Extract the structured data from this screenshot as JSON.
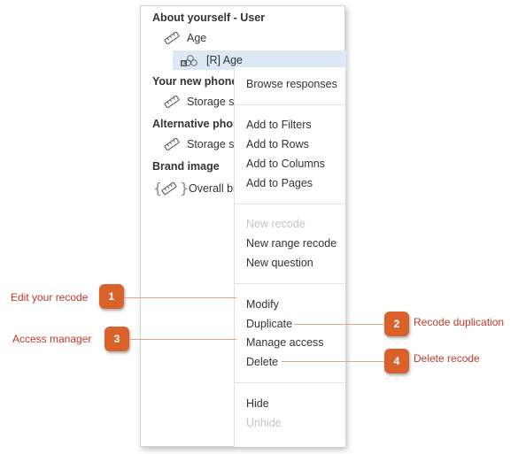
{
  "tree": {
    "group_about": "About yourself - User",
    "item_age": "Age",
    "item_recode_age": "[R] Age",
    "group_phone": "Your new phone",
    "item_storage_1": "Storage si",
    "group_alt": "Alternative phon",
    "item_storage_2": "Storage si",
    "group_brand": "Brand image",
    "item_overall": "Overall br"
  },
  "menu": {
    "browse_responses": "Browse responses",
    "add_to_filters": "Add to Filters",
    "add_to_rows": "Add to Rows",
    "add_to_columns": "Add to Columns",
    "add_to_pages": "Add to Pages",
    "new_recode": "New recode",
    "new_range_recode": "New range recode",
    "new_question": "New question",
    "modify": "Modify",
    "duplicate": "Duplicate",
    "manage_access": "Manage access",
    "delete": "Delete",
    "hide": "Hide",
    "unhide": "Unhide"
  },
  "callouts": {
    "c1_label": "Edit your recode",
    "c1_num": "1",
    "c2_label": "Recode duplication",
    "c2_num": "2",
    "c3_label": "Access manager",
    "c3_num": "3",
    "c4_label": "Delete recode",
    "c4_num": "4"
  },
  "colors": {
    "accent_badge": "#d9622b",
    "callout_text": "#c0392b",
    "selection": "#dde8f6",
    "disabled_text": "#c4c4c4"
  },
  "icons": {
    "ruler": "ruler-icon",
    "recode": "recode-icon",
    "braces": "braces-icon"
  }
}
